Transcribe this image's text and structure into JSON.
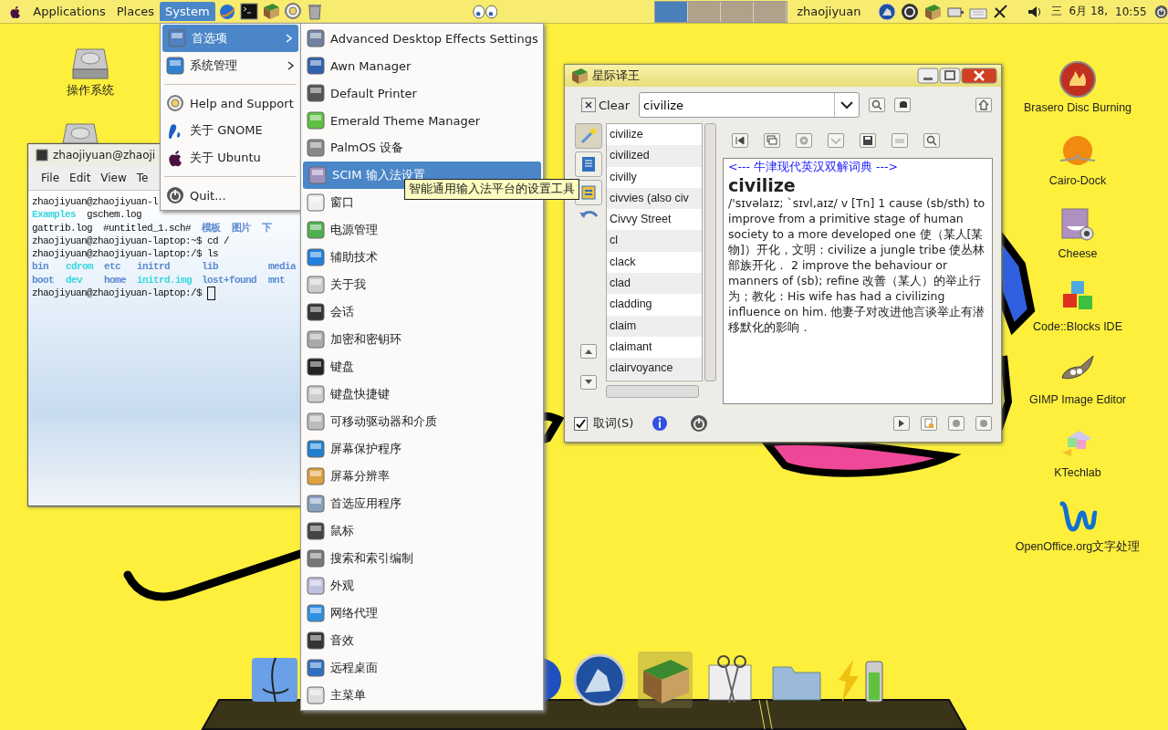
{
  "top_panel": {
    "menus": [
      {
        "label": "Applications",
        "selected": false
      },
      {
        "label": "Places",
        "selected": false
      },
      {
        "label": "System",
        "selected": true
      }
    ],
    "workspaces": [
      {
        "selected": true
      },
      {
        "selected": false
      },
      {
        "selected": false
      },
      {
        "selected": false
      }
    ],
    "user": "zhaojiyuan",
    "weekday": "三",
    "date": "6月 18,",
    "time": "10:55"
  },
  "desktop_icons_left": [
    {
      "label": "操作系统"
    }
  ],
  "desktop_icons_right": [
    {
      "label": "Brasero Disc Burning"
    },
    {
      "label": "Cairo-Dock"
    },
    {
      "label": "Cheese"
    },
    {
      "label": "Code::Blocks IDE"
    },
    {
      "label": "GIMP Image Editor"
    },
    {
      "label": "KTechlab"
    },
    {
      "label": "OpenOffice.org文字处理"
    }
  ],
  "terminal": {
    "title": "zhaojiyuan@zhaoji",
    "menu": [
      "File",
      "Edit",
      "View",
      "Te"
    ],
    "lines": [
      {
        "kind": "plain",
        "segments": [
          {
            "text": "zhaojiyuan@zhaojiyuan-l",
            "kind": "text"
          }
        ]
      },
      {
        "kind": "plain",
        "segments": [
          {
            "text": "Examples",
            "kind": "link"
          },
          {
            "text": "gschem.log",
            "kind": "text"
          }
        ]
      },
      {
        "kind": "plain",
        "segments": [
          {
            "text": "gattrib.log",
            "kind": "text"
          },
          {
            "text": "#untitled_1.sch#",
            "kind": "text"
          },
          {
            "text": "模板",
            "kind": "dir"
          },
          {
            "text": "图片",
            "kind": "dir"
          },
          {
            "text": "下",
            "kind": "dir"
          }
        ]
      },
      {
        "kind": "plain",
        "segments": [
          {
            "text": "zhaojiyuan@zhaojiyuan-laptop:~$ cd /",
            "kind": "text"
          }
        ]
      },
      {
        "kind": "plain",
        "segments": [
          {
            "text": "zhaojiyuan@zhaojiyuan-laptop:/$ ls",
            "kind": "text"
          }
        ]
      },
      {
        "kind": "grid",
        "segments": [
          {
            "text": "bin",
            "kind": "dir"
          },
          {
            "text": "cdrom",
            "kind": "link"
          },
          {
            "text": "etc",
            "kind": "dir"
          },
          {
            "text": "initrd",
            "kind": "dir"
          },
          {
            "text": "lib",
            "kind": "dir"
          },
          {
            "text": "media",
            "kind": "dir"
          }
        ]
      },
      {
        "kind": "grid",
        "segments": [
          {
            "text": "boot",
            "kind": "dir"
          },
          {
            "text": "dev",
            "kind": "link"
          },
          {
            "text": "home",
            "kind": "dir"
          },
          {
            "text": "initrd.img",
            "kind": "link"
          },
          {
            "text": "lost+found",
            "kind": "dir"
          },
          {
            "text": "mnt",
            "kind": "dir"
          }
        ]
      },
      {
        "kind": "prompt",
        "segments": [
          {
            "text": "zhaojiyuan@zhaojiyuan-laptop:/$",
            "kind": "text"
          }
        ]
      }
    ]
  },
  "system_menu": [
    {
      "kind": "item",
      "label": "首选项",
      "selected": true,
      "submenu": true
    },
    {
      "kind": "item",
      "label": "系统管理",
      "selected": false,
      "submenu": true
    },
    {
      "kind": "separator"
    },
    {
      "kind": "item",
      "label": "Help and Support",
      "selected": false,
      "submenu": false
    },
    {
      "kind": "item",
      "label": "关于 GNOME",
      "selected": false,
      "submenu": false
    },
    {
      "kind": "item",
      "label": "关于 Ubuntu",
      "selected": false,
      "submenu": false
    },
    {
      "kind": "separator"
    },
    {
      "kind": "item",
      "label": "Quit...",
      "selected": false,
      "submenu": false
    }
  ],
  "preferences_menu": {
    "items": [
      {
        "label": "Advanced Desktop Effects Settings",
        "selected": false
      },
      {
        "label": "Awn Manager",
        "selected": false
      },
      {
        "label": "Default Printer",
        "selected": false
      },
      {
        "label": "Emerald Theme Manager",
        "selected": false
      },
      {
        "label": "PalmOS 设备",
        "selected": false
      },
      {
        "label": "SCIM 输入法设置",
        "selected": true
      },
      {
        "label": "窗口",
        "selected": false
      },
      {
        "label": "电源管理",
        "selected": false
      },
      {
        "label": "辅助技术",
        "selected": false
      },
      {
        "label": "关于我",
        "selected": false
      },
      {
        "label": "会话",
        "selected": false
      },
      {
        "label": "加密和密钥环",
        "selected": false
      },
      {
        "label": "键盘",
        "selected": false
      },
      {
        "label": "键盘快捷键",
        "selected": false
      },
      {
        "label": "可移动驱动器和介质",
        "selected": false
      },
      {
        "label": "屏幕保护程序",
        "selected": false
      },
      {
        "label": "屏幕分辨率",
        "selected": false
      },
      {
        "label": "首选应用程序",
        "selected": false
      },
      {
        "label": "鼠标",
        "selected": false
      },
      {
        "label": "搜索和索引编制",
        "selected": false
      },
      {
        "label": "外观",
        "selected": false
      },
      {
        "label": "网络代理",
        "selected": false
      },
      {
        "label": "音效",
        "selected": false
      },
      {
        "label": "远程桌面",
        "selected": false
      },
      {
        "label": "主菜单",
        "selected": false
      }
    ],
    "tooltip": "智能通用输入法平台的设置工具"
  },
  "dictionary": {
    "title": "星际译王",
    "clear": "Clear",
    "query": "civilize",
    "words": [
      "civilize",
      "civilized",
      "civilly",
      "civvies (also civ",
      "Civvy Street",
      "cl",
      "clack",
      "clad",
      "cladding",
      "claim",
      "claimant",
      "clairvoyance"
    ],
    "source": "<--- 牛津现代英汉双解词典 --->",
    "headword": "civilize",
    "definition": "/'sɪvəlaɪz; `sɪvl,aɪz/ v [Tn]  1 cause (sb/sth) to improve from a primitive stage of human society to a more developed one 使（某人[某物]）开化，文明：civilize a jungle tribe 使丛林部族开化．  2 improve the behaviour or manners of (sb); refine 改善（某人）的举止行为；教化：His wife has had a civilizing influence on him. 他妻子对改进他言谈举止有潜移默化的影响．",
    "scan": {
      "label": "取词(S)",
      "checked": true
    }
  },
  "dock": [
    {
      "active": false
    },
    {
      "active": false
    },
    {
      "active": false
    },
    {
      "active": true
    },
    {
      "active": false
    },
    {
      "active": false
    },
    {
      "active": false
    }
  ]
}
